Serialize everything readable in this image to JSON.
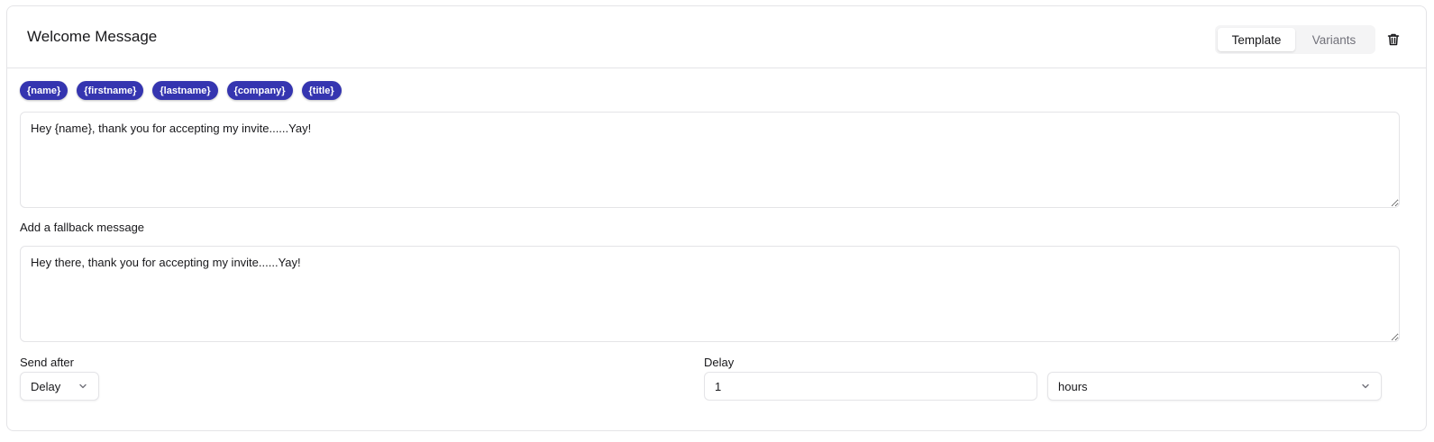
{
  "header": {
    "title": "Welcome Message",
    "tabs": [
      {
        "label": "Template",
        "active": true
      },
      {
        "label": "Variants",
        "active": false
      }
    ],
    "delete_icon": "trash-icon"
  },
  "variables": [
    "{name}",
    "{firstname}",
    "{lastname}",
    "{company}",
    "{title}"
  ],
  "message": {
    "value": "Hey {name}, thank you for accepting my invite......Yay!"
  },
  "fallback": {
    "label": "Add a fallback message",
    "value": "Hey there, thank you for accepting my invite......Yay!"
  },
  "send_after": {
    "label": "Send after",
    "selected": "Delay"
  },
  "delay": {
    "label": "Delay",
    "value": "1",
    "unit": "hours"
  },
  "colors": {
    "chip_bg": "#3535b0",
    "border": "#e4e4e7",
    "muted_text": "#71717a"
  }
}
